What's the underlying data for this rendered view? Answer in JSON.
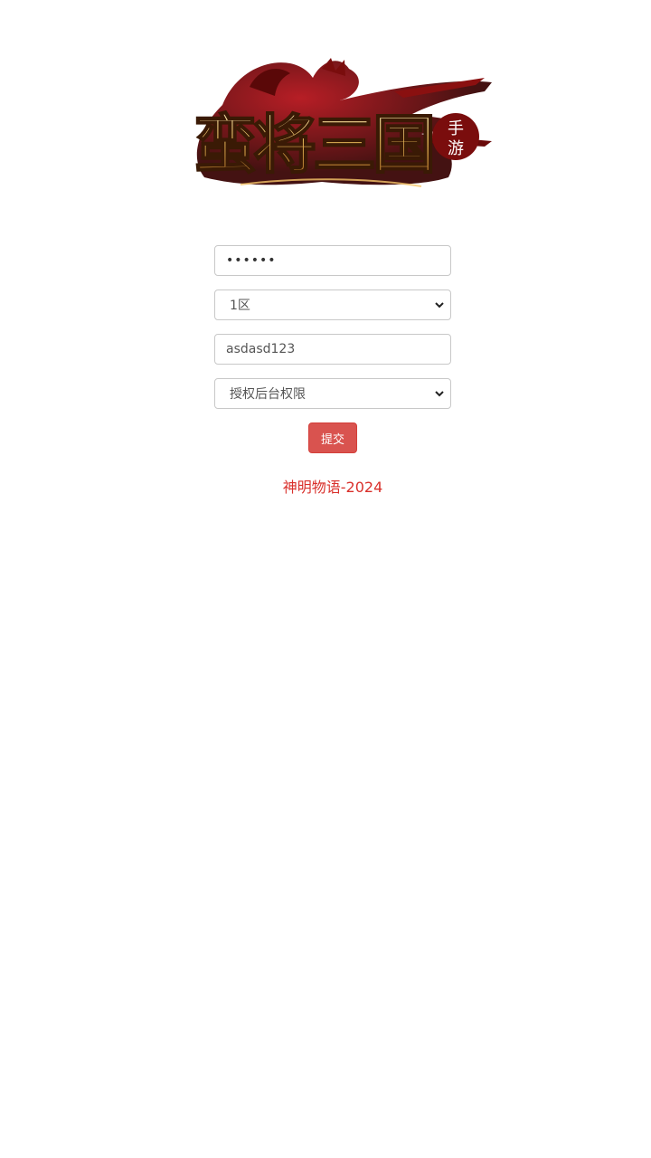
{
  "logo": {
    "main_text": "蛮将三国",
    "badge_text_top": "手",
    "badge_text_bottom": "游"
  },
  "form": {
    "password_value": "••••••",
    "server_select_value": "1区",
    "account_input_value": "asdasd123",
    "permission_select_value": "授权后台权限",
    "submit_label": "提交"
  },
  "footer": {
    "copyright": "神明物语-2024"
  },
  "colors": {
    "accent_red": "#d9534f",
    "footer_red": "#d9302b",
    "logo_gold": "#e8b95a",
    "logo_dark_red": "#7a0d0d"
  }
}
